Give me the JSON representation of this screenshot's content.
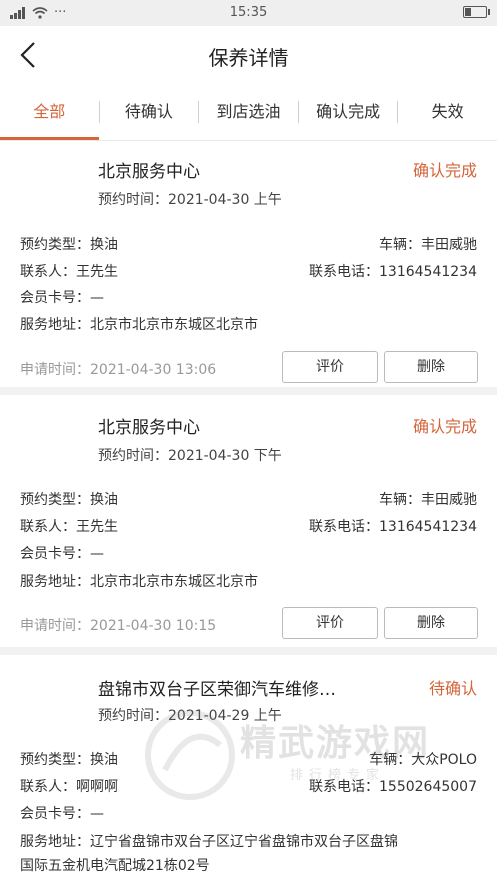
{
  "status_bar": {
    "time": "15:35"
  },
  "nav": {
    "title": "保养详情"
  },
  "tabs": [
    {
      "label": "全部",
      "active": true
    },
    {
      "label": "待确认"
    },
    {
      "label": "到店选油"
    },
    {
      "label": "确认完成"
    },
    {
      "label": "失效"
    }
  ],
  "labels": {
    "appt_prefix": "预约时间：",
    "type_prefix": "预约类型：",
    "vehicle_prefix": "车辆：",
    "contact_prefix": "联系人：",
    "phone_prefix": "联系电话：",
    "member_prefix": "会员卡号：",
    "address_prefix": "服务地址：",
    "apply_prefix": "申请时间：",
    "review_button": "评价",
    "delete_button": "删除"
  },
  "orders": [
    {
      "center": "北京服务中心",
      "status": "确认完成",
      "appt_time": "2021-04-30 上午",
      "type": "换油",
      "vehicle": "丰田威驰",
      "contact": "王先生",
      "phone": "13164541234",
      "member_no": "—",
      "address": "北京市北京市东城区北京市",
      "apply_time": "2021-04-30 13:06"
    },
    {
      "center": "北京服务中心",
      "status": "确认完成",
      "appt_time": "2021-04-30 下午",
      "type": "换油",
      "vehicle": "丰田威驰",
      "contact": "王先生",
      "phone": "13164541234",
      "member_no": "—",
      "address": "北京市北京市东城区北京市",
      "apply_time": "2021-04-30 10:15"
    },
    {
      "center": "盘锦市双台子区荣御汽车维修…",
      "status": "待确认",
      "appt_time": "2021-04-29 上午",
      "type": "换油",
      "vehicle": "大众POLO",
      "contact": "啊啊啊",
      "phone": "15502645007",
      "member_no": "—",
      "address_line1": "辽宁省盘锦市双台子区辽宁省盘锦市双台子区盘锦",
      "address_line2": "国际五金机电汽配城21栋02号"
    }
  ],
  "watermark": {
    "text": "精武游戏网",
    "sub": "排行榜专家"
  }
}
